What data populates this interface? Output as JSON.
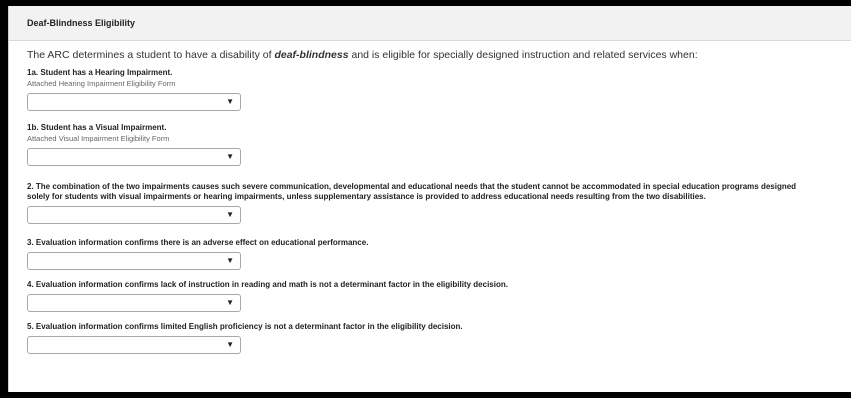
{
  "section": {
    "title": "Deaf-Blindness Eligibility",
    "intro_before": "The ARC determines a student to have a disability of ",
    "intro_emphasis": "deaf-blindness",
    "intro_after": " and is eligible for specially designed instruction and related services when:"
  },
  "questions": [
    {
      "label": "1a. Student has a Hearing Impairment.",
      "sublabel": "Attached Hearing Impairment Eligibility Form",
      "value": ""
    },
    {
      "label": "1b. Student has a Visual Impairment.",
      "sublabel": "Attached Visual Impairment Eligibility Form",
      "value": ""
    },
    {
      "label": "2. The combination of the two impairments causes such severe communication, developmental and educational needs that the student cannot be accommodated in special education programs designed solely for students with visual impairments or hearing impairments, unless supplementary assistance is provided to address educational needs resulting from the two disabilities.",
      "value": ""
    },
    {
      "label": "3. Evaluation information confirms there is an adverse effect on educational performance.",
      "value": ""
    },
    {
      "label": "4. Evaluation information confirms lack of instruction in reading and math is not a determinant factor in the eligibility decision.",
      "value": ""
    },
    {
      "label": "5. Evaluation information confirms limited English proficiency is not a determinant factor in the eligibility decision.",
      "value": ""
    }
  ],
  "icons": {
    "dropdown": "chevron-down-icon"
  }
}
